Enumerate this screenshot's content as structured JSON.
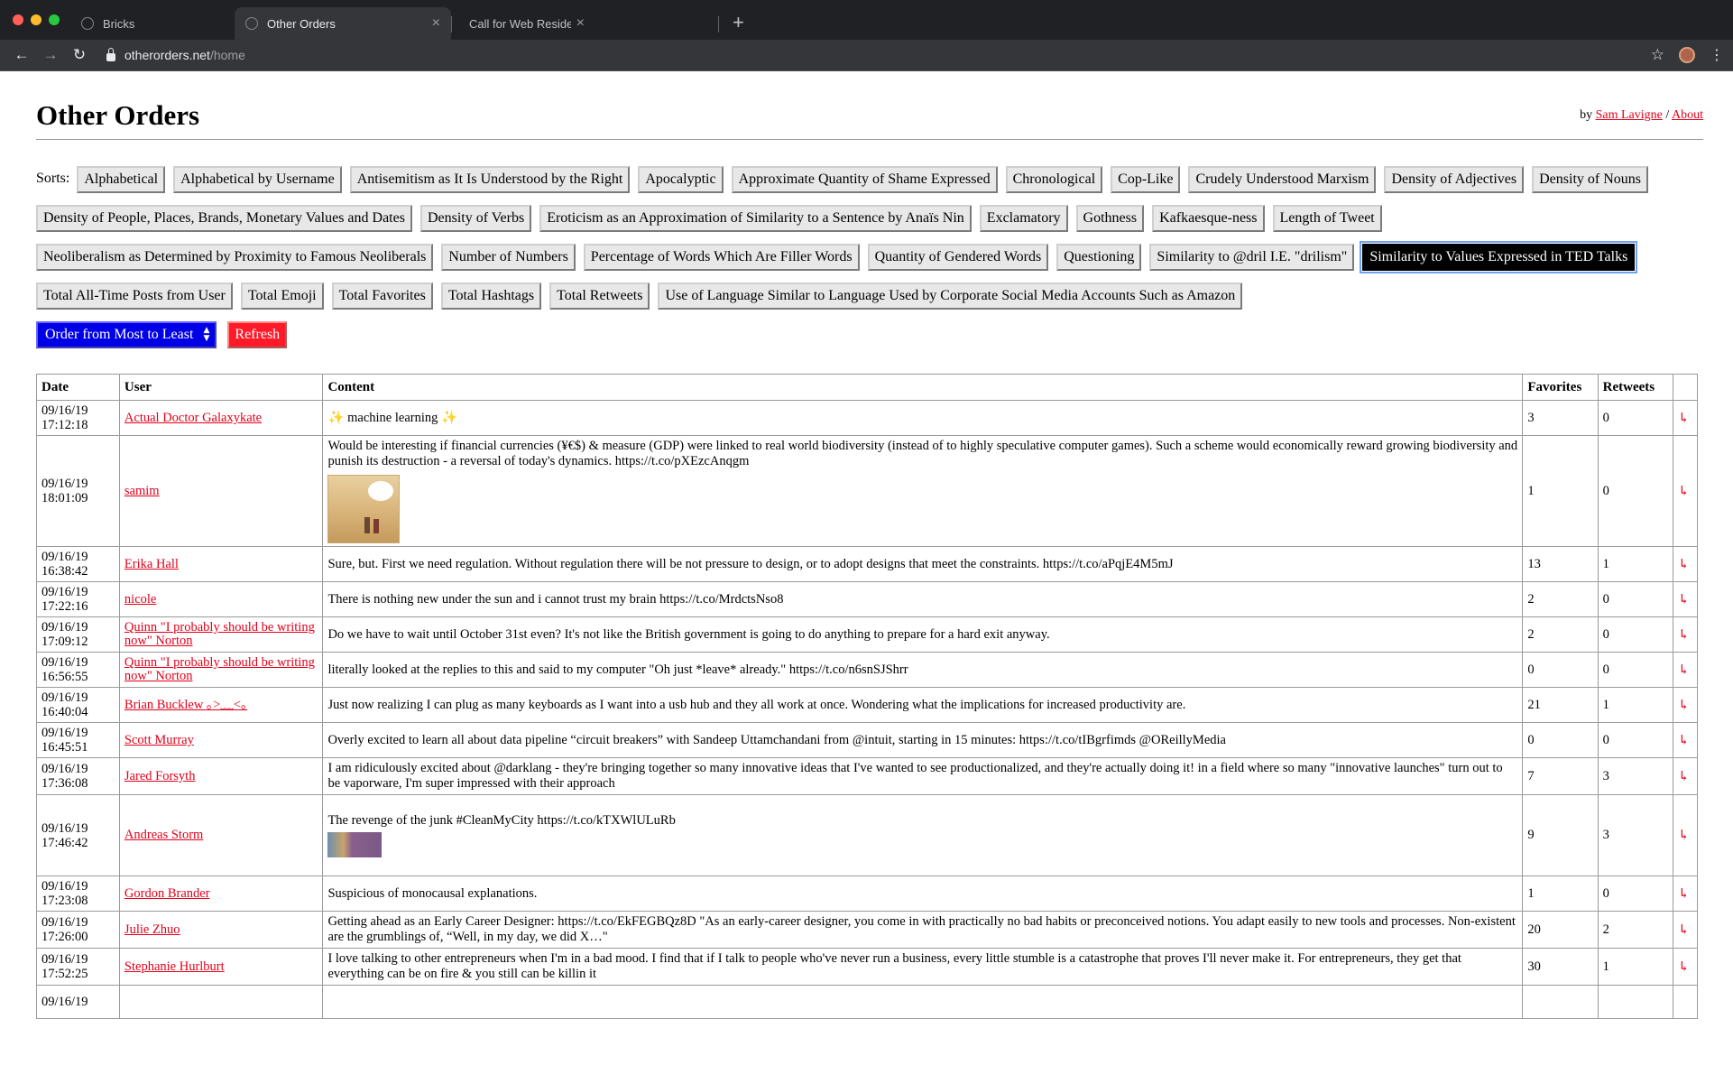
{
  "browser": {
    "tabs": [
      {
        "title": "Bricks",
        "close": "×"
      },
      {
        "title": "Other Orders",
        "close": "×"
      },
      {
        "title": "Call for Web Residencies by Sc",
        "close": "×"
      }
    ],
    "new_tab": "+",
    "back": "←",
    "forward": "→",
    "reload": "↻",
    "url_host": "otherorders.net",
    "url_path": "/home",
    "star": "☆",
    "menu": "⋮",
    "colors": {
      "close": "#ff5f57",
      "minimize": "#febc2e",
      "maximize": "#28c840"
    }
  },
  "site": {
    "title": "Other Orders",
    "by_label": "by",
    "author": "Sam Lavigne",
    "separator": "/",
    "about": "About"
  },
  "sorts": {
    "label": "Sorts:",
    "options": [
      "Alphabetical",
      "Alphabetical by Username",
      "Antisemitism as It Is Understood by the Right",
      "Apocalyptic",
      "Approximate Quantity of Shame Expressed",
      "Chronological",
      "Cop-Like",
      "Crudely Understood Marxism",
      "Density of Adjectives",
      "Density of Nouns",
      "Density of People, Places, Brands, Monetary Values and Dates",
      "Density of Verbs",
      "Eroticism as an Approximation of Similarity to a Sentence by Anaïs Nin",
      "Exclamatory",
      "Gothness",
      "Kafkaesque-ness",
      "Length of Tweet",
      "Neoliberalism as Determined by Proximity to Famous Neoliberals",
      "Number of Numbers",
      "Percentage of Words Which Are Filler Words",
      "Quantity of Gendered Words",
      "Questioning",
      "Similarity to @dril I.E. \"drilism\"",
      "Similarity to Values Expressed in TED Talks",
      "Total All-Time Posts from User",
      "Total Emoji",
      "Total Favorites",
      "Total Hashtags",
      "Total Retweets",
      "Use of Language Similar to Language Used by Corporate Social Media Accounts Such as Amazon"
    ],
    "active": "Similarity to Values Expressed in TED Talks",
    "order": "Order from Most to Least",
    "refresh": "Refresh",
    "colors": {
      "order_bg": "#0000e6",
      "refresh_bg": "#ff1a2a",
      "active_bg": "#000000"
    }
  },
  "table": {
    "headers": {
      "date": "Date",
      "user": "User",
      "content": "Content",
      "favorites": "Favorites",
      "retweets": "Retweets"
    },
    "share_icon": "↳",
    "rows": [
      {
        "date": "09/16/19 17:12:18",
        "user": "Actual Doctor Galaxykate",
        "content": "✨ machine learning ✨",
        "favorites": "3",
        "retweets": "0",
        "image": ""
      },
      {
        "date": "09/16/19 18:01:09",
        "user": "samim",
        "content": "Would be interesting if financial currencies (¥€$) & measure (GDP) were linked to real world biodiversity (instead of to highly speculative computer games). Such a scheme would economically reward growing biodiversity and punish its destruction - a reversal of today's dynamics. https://t.co/pXEzcAnqgm",
        "favorites": "1",
        "retweets": "0",
        "image": "comic"
      },
      {
        "date": "09/16/19 16:38:42",
        "user": "Erika Hall",
        "content": "Sure, but. First we need regulation. Without regulation there will be not pressure to design, or to adopt designs that meet the constraints. https://t.co/aPqjE4M5mJ",
        "favorites": "13",
        "retweets": "1",
        "image": ""
      },
      {
        "date": "09/16/19 17:22:16",
        "user": "nicole",
        "content": "There is nothing new under the sun and i cannot trust my brain https://t.co/MrdctsNso8",
        "favorites": "2",
        "retweets": "0",
        "image": ""
      },
      {
        "date": "09/16/19 17:09:12",
        "user": "Quinn \"I probably should be writing now\" Norton",
        "content": "Do we have to wait until October 31st even? It's not like the British government is going to do anything to prepare for a hard exit anyway.",
        "favorites": "2",
        "retweets": "0",
        "image": ""
      },
      {
        "date": "09/16/19 16:56:55",
        "user": "Quinn \"I probably should be writing now\" Norton",
        "content": "literally looked at the replies to this and said to my computer \"Oh just *leave* already.\" https://t.co/n6snSJShrr",
        "favorites": "0",
        "retweets": "0",
        "image": ""
      },
      {
        "date": "09/16/19 16:40:04",
        "user": "Brian Bucklew ｡>﹏<｡",
        "content": "Just now realizing I can plug as many keyboards as I want into a usb hub and they all work at once. Wondering what the implications for increased productivity are.",
        "favorites": "21",
        "retweets": "1",
        "image": ""
      },
      {
        "date": "09/16/19 16:45:51",
        "user": "Scott Murray",
        "content": "Overly excited to learn all about data pipeline “circuit breakers” with Sandeep Uttamchandani from @intuit, starting in 15 minutes: https://t.co/tIBgrfimds @OReillyMedia",
        "favorites": "0",
        "retweets": "0",
        "image": ""
      },
      {
        "date": "09/16/19 17:36:08",
        "user": "Jared Forsyth",
        "content": "I am ridiculously excited about @darklang - they're bringing together so many innovative ideas that I've wanted to see productionalized, and they're actually doing it! in a field where so many \"innovative launches\" turn out to be vaporware, I'm super impressed with their approach",
        "favorites": "7",
        "retweets": "3",
        "image": ""
      },
      {
        "date": "09/16/19 17:46:42",
        "user": "Andreas Storm",
        "content": "The revenge of the junk #CleanMyCity https://t.co/kTXWlULuRb",
        "favorites": "9",
        "retweets": "3",
        "image": "strip"
      },
      {
        "date": "09/16/19 17:23:08",
        "user": "Gordon Brander",
        "content": "Suspicious of monocausal explanations.",
        "favorites": "1",
        "retweets": "0",
        "image": ""
      },
      {
        "date": "09/16/19 17:26:00",
        "user": "Julie Zhuo",
        "content": "Getting ahead as an Early Career Designer: https://t.co/EkFEGBQz8D \"As an early-career designer, you come in with practically no bad habits or preconceived notions. You adapt easily to new tools and processes. Non-existent are the grumblings of, “Well, in my day, we did X…\"",
        "favorites": "20",
        "retweets": "2",
        "image": ""
      },
      {
        "date": "09/16/19 17:52:25",
        "user": "Stephanie Hurlburt",
        "content": "I love talking to other entrepreneurs when I'm in a bad mood. I find that if I talk to people who've never run a business, every little stumble is a catastrophe that proves I'll never make it. For entrepreneurs, they get that everything can be on fire & you still can be killin it",
        "favorites": "30",
        "retweets": "1",
        "image": ""
      },
      {
        "date": "09/16/19",
        "user": "",
        "content": "",
        "favorites": "",
        "retweets": "",
        "image": ""
      }
    ]
  }
}
